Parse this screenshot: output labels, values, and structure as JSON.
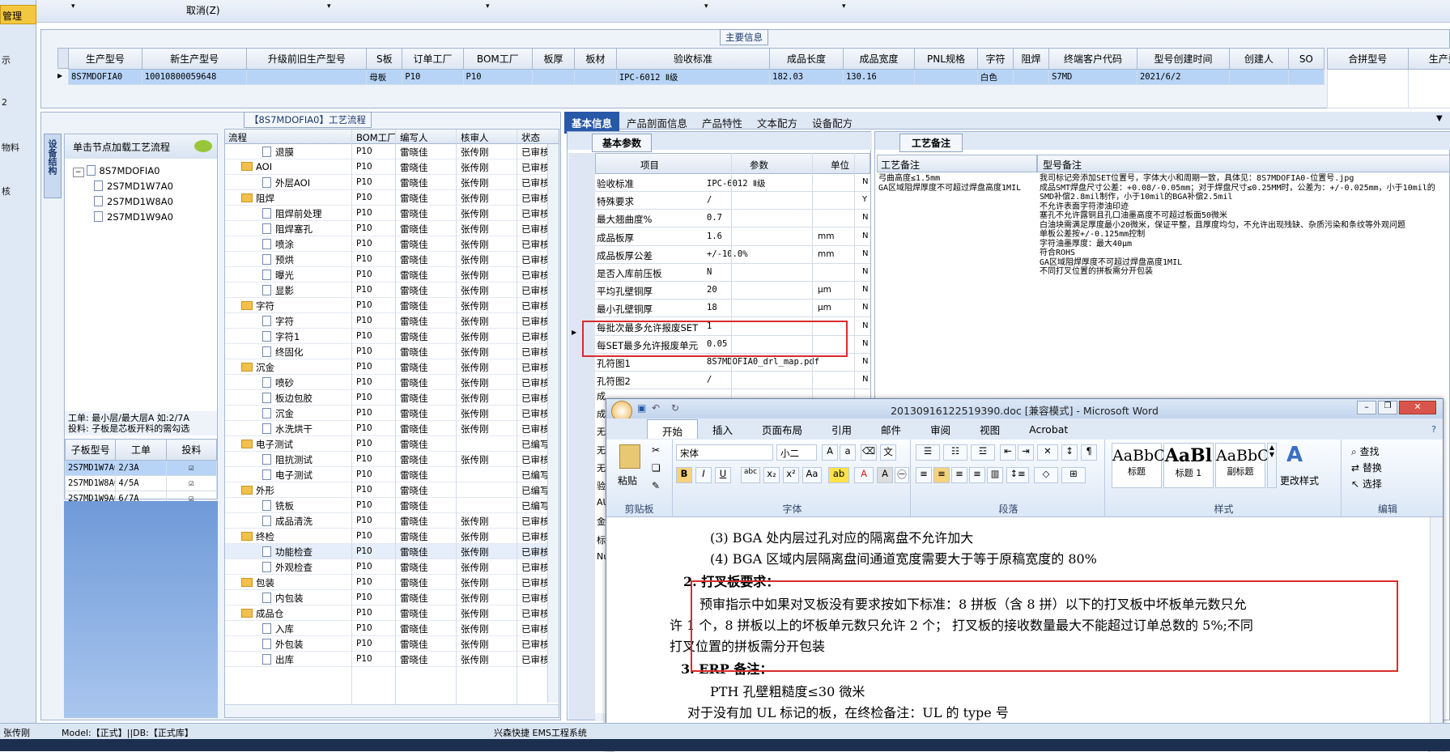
{
  "toolbar": {
    "cancel": "取消(Z)"
  },
  "leftnav": {
    "items": [
      "管理",
      "示",
      "2",
      "物料",
      "核"
    ]
  },
  "main_info": {
    "caption": "主要信息",
    "headers": [
      "生产型号",
      "新生产型号",
      "升级前旧生产型号",
      "S板",
      "订单工厂",
      "BOM工厂",
      "板厚",
      "板材",
      "验收标准",
      "成品长度",
      "成品宽度",
      "PNL规格",
      "字符",
      "阻焊",
      "终端客户代码",
      "型号创建时间",
      "创建人",
      "SO"
    ],
    "row": [
      "8S7MDOFIA0",
      "10010800059648",
      "",
      "母板",
      "P10",
      "P10",
      "",
      "",
      "IPC-6012 Ⅱ级",
      "182.03",
      "130.16",
      "",
      "白色",
      "",
      "S7MD",
      "2021/6/2",
      "",
      ""
    ],
    "merge_headers": [
      "合拼型号",
      "生产型号"
    ]
  },
  "process": {
    "caption": "【8S7MDOFIA0】工艺流程",
    "side_tab": "设备结构",
    "hint": "单击节点加载工艺流程",
    "tree_root": "8S7MDOFIA0",
    "tree_children": [
      "2S7MD1W7A0",
      "2S7MD1W8A0",
      "2S7MD1W9A0"
    ],
    "info1": "工单: 最小层/最大层A 如:2/7A",
    "info2": "投料: 子板是芯板开料的需勾选",
    "sub_headers": [
      "子板型号",
      "工单",
      "投料"
    ],
    "sub_rows": [
      [
        "2S7MD1W7A0",
        "2/3A"
      ],
      [
        "2S7MD1W8A0",
        "4/5A"
      ],
      [
        "2S7MD1W9A0",
        "6/7A"
      ]
    ],
    "headers": [
      "流程",
      "BOM工厂",
      "编写人",
      "核审人",
      "状态"
    ],
    "rows": [
      {
        "t": "d",
        "n": "退膜",
        "f": "P10",
        "w": "雷晓佳",
        "r": "张传刚",
        "s": "已审核"
      },
      {
        "t": "f",
        "n": "AOI",
        "f": "P10",
        "w": "雷晓佳",
        "r": "张传刚",
        "s": "已审核"
      },
      {
        "t": "d",
        "n": "外层AOI",
        "f": "P10",
        "w": "雷晓佳",
        "r": "张传刚",
        "s": "已审核"
      },
      {
        "t": "f",
        "n": "阻焊",
        "f": "P10",
        "w": "雷晓佳",
        "r": "张传刚",
        "s": "已审核"
      },
      {
        "t": "d",
        "n": "阻焊前处理",
        "f": "P10",
        "w": "雷晓佳",
        "r": "张传刚",
        "s": "已审核"
      },
      {
        "t": "d",
        "n": "阻焊塞孔",
        "f": "P10",
        "w": "雷晓佳",
        "r": "张传刚",
        "s": "已审核"
      },
      {
        "t": "d",
        "n": "喷涂",
        "f": "P10",
        "w": "雷晓佳",
        "r": "张传刚",
        "s": "已审核"
      },
      {
        "t": "d",
        "n": "预烘",
        "f": "P10",
        "w": "雷晓佳",
        "r": "张传刚",
        "s": "已审核"
      },
      {
        "t": "d",
        "n": "曝光",
        "f": "P10",
        "w": "雷晓佳",
        "r": "张传刚",
        "s": "已审核"
      },
      {
        "t": "d",
        "n": "显影",
        "f": "P10",
        "w": "雷晓佳",
        "r": "张传刚",
        "s": "已审核"
      },
      {
        "t": "f",
        "n": "字符",
        "f": "P10",
        "w": "雷晓佳",
        "r": "张传刚",
        "s": "已审核"
      },
      {
        "t": "d",
        "n": "字符",
        "f": "P10",
        "w": "雷晓佳",
        "r": "张传刚",
        "s": "已审核"
      },
      {
        "t": "d",
        "n": "字符1",
        "f": "P10",
        "w": "雷晓佳",
        "r": "张传刚",
        "s": "已审核"
      },
      {
        "t": "d",
        "n": "终固化",
        "f": "P10",
        "w": "雷晓佳",
        "r": "张传刚",
        "s": "已审核"
      },
      {
        "t": "f",
        "n": "沉金",
        "f": "P10",
        "w": "雷晓佳",
        "r": "张传刚",
        "s": "已审核"
      },
      {
        "t": "d",
        "n": "喷砂",
        "f": "P10",
        "w": "雷晓佳",
        "r": "张传刚",
        "s": "已审核"
      },
      {
        "t": "d",
        "n": "板边包胶",
        "f": "P10",
        "w": "雷晓佳",
        "r": "张传刚",
        "s": "已审核"
      },
      {
        "t": "d",
        "n": "沉金",
        "f": "P10",
        "w": "雷晓佳",
        "r": "张传刚",
        "s": "已审核"
      },
      {
        "t": "d",
        "n": "水洗烘干",
        "f": "P10",
        "w": "雷晓佳",
        "r": "张传刚",
        "s": "已审核"
      },
      {
        "t": "f",
        "n": "电子测试",
        "f": "P10",
        "w": "雷晓佳",
        "r": "",
        "s": "已编写"
      },
      {
        "t": "d",
        "n": "阻抗测试",
        "f": "P10",
        "w": "雷晓佳",
        "r": "张传刚",
        "s": "已审核"
      },
      {
        "t": "d",
        "n": "电子测试",
        "f": "P10",
        "w": "雷晓佳",
        "r": "",
        "s": "已编写"
      },
      {
        "t": "f",
        "n": "外形",
        "f": "P10",
        "w": "雷晓佳",
        "r": "",
        "s": "已编写"
      },
      {
        "t": "d",
        "n": "铣板",
        "f": "P10",
        "w": "雷晓佳",
        "r": "",
        "s": "已编写"
      },
      {
        "t": "d",
        "n": "成品清洗",
        "f": "P10",
        "w": "雷晓佳",
        "r": "张传刚",
        "s": "已审核"
      },
      {
        "t": "f",
        "n": "终检",
        "f": "P10",
        "w": "雷晓佳",
        "r": "张传刚",
        "s": "已审核"
      },
      {
        "t": "d",
        "n": "功能检查",
        "f": "P10",
        "w": "雷晓佳",
        "r": "张传刚",
        "s": "已审核"
      },
      {
        "t": "d",
        "n": "外观检查",
        "f": "P10",
        "w": "雷晓佳",
        "r": "张传刚",
        "s": "已审核"
      },
      {
        "t": "f",
        "n": "包装",
        "f": "P10",
        "w": "雷晓佳",
        "r": "张传刚",
        "s": "已审核"
      },
      {
        "t": "d",
        "n": "内包装",
        "f": "P10",
        "w": "雷晓佳",
        "r": "张传刚",
        "s": "已审核"
      },
      {
        "t": "f",
        "n": "成品仓",
        "f": "P10",
        "w": "雷晓佳",
        "r": "张传刚",
        "s": "已审核"
      },
      {
        "t": "d",
        "n": "入库",
        "f": "P10",
        "w": "雷晓佳",
        "r": "张传刚",
        "s": "已审核"
      },
      {
        "t": "d",
        "n": "外包装",
        "f": "P10",
        "w": "雷晓佳",
        "r": "张传刚",
        "s": "已审核"
      },
      {
        "t": "d",
        "n": "出库",
        "f": "P10",
        "w": "雷晓佳",
        "r": "张传刚",
        "s": "已审核"
      }
    ]
  },
  "info_tabs": [
    "基本信息",
    "产品剖面信息",
    "产品特性",
    "文本配方",
    "设备配方"
  ],
  "basic": {
    "caption": "基本参数",
    "headers": [
      "项目",
      "参数",
      "单位"
    ],
    "rows": [
      [
        "验收标准",
        "IPC-6012 Ⅱ级",
        "",
        "N"
      ],
      [
        "特殊要求",
        "/",
        "",
        "Y"
      ],
      [
        "最大翘曲度%",
        "0.7",
        "",
        "N"
      ],
      [
        "成品板厚",
        "1.6",
        "mm",
        "N"
      ],
      [
        "成品板厚公差",
        "+/-10.0%",
        "mm",
        "N"
      ],
      [
        "是否入库前压板",
        "N",
        "",
        "N"
      ],
      [
        "平均孔壁铜厚",
        "20",
        "μm",
        "N"
      ],
      [
        "最小孔壁铜厚",
        "18",
        "μm",
        "N"
      ],
      [
        "每批次最多允许报废SET",
        "1",
        "",
        "N"
      ],
      [
        "每SET最多允许报废单元",
        "0.05",
        "",
        "N"
      ],
      [
        "孔符图1",
        "8S7MDOFIA0_drl_map.pdf",
        "",
        "N"
      ],
      [
        "孔符图2",
        "/",
        "",
        "N"
      ]
    ],
    "hidden_rows": [
      "成",
      "成",
      "无",
      "无",
      "无",
      "验",
      "AU",
      "金",
      "标",
      "Nu"
    ]
  },
  "process_notes": {
    "caption": "工艺备注",
    "h1": "工艺备注",
    "h2": "型号备注",
    "col1": [
      "弓曲高度≤1.5mm",
      "GA区域阻焊厚度不可超过焊盘高度1MIL"
    ],
    "col2": [
      "我司标记旁添加SET位置号，字体大小和周期一致，具体见：8S7MDOFIA0-位置号.jpg",
      "成品SMT焊盘尺寸公差：+0.08/-0.05mm；对于焊盘尺寸≤0.25MM时，公差为：+/-0.025mm，小于10mil的SMD补偿2.8mil制作，小于10mil的BGA补偿2.5mil",
      "不允许表面字符渗油印迹",
      "塞孔不允许露铜且孔口油墨高度不可超过板面50微米",
      "白油块需满足厚度最小20微米，保证平整，且厚度均匀，不允许出现残缺、杂质污染和条纹等外观问题",
      "单板公差按+/-0.125mm控制",
      "字符油墨厚度：最大40μm",
      "符合ROHS",
      "GA区域阻焊厚度不可超过焊盘高度1MIL",
      "不同打叉位置的拼板需分开包装"
    ]
  },
  "word": {
    "title": "20130916122519390.doc [兼容模式] - Microsoft Word",
    "tabs": [
      "开始",
      "插入",
      "页面布局",
      "引用",
      "邮件",
      "审阅",
      "视图",
      "Acrobat"
    ],
    "font": "宋体",
    "size": "小二",
    "groups": [
      "剪贴板",
      "字体",
      "段落",
      "样式",
      "编辑"
    ],
    "paste": "粘贴",
    "styles": [
      "标题",
      "标题 1",
      "副标题"
    ],
    "style_prev": [
      "AaBbC",
      "AaBl",
      "AaBbC"
    ],
    "change_style": "更改样式",
    "edit": [
      "查找",
      "替换",
      "选择"
    ],
    "lines": [
      "(3) BGA 处内层过孔对应的隔离盘不允许加大",
      "(4) BGA 区域内层隔离盘间通道宽度需要大于等于原稿宽度的 80%",
      "2. 打叉板要求：",
      "预审指示中如果对叉板没有要求按如下标准：8 拼板（含 8 拼）以下的打叉板中坏板单元数只允",
      "许 1 个，8 拼板以上的坏板单元数只允许 2 个；  打叉板的接收数量最大不能超过订单总数的 5%;不同",
      "打叉位置的拼板需分开包装",
      "3. ERP 备注：",
      "PTH 孔壁粗糙度≤30 微米",
      "对于没有加 UL 标记的板，在终检备注：UL 的 type 号"
    ]
  },
  "status": {
    "user": "张传刚",
    "model": "Model:【正式】||DB:【正式库】",
    "company": "兴森快捷 EMS工程系统"
  }
}
